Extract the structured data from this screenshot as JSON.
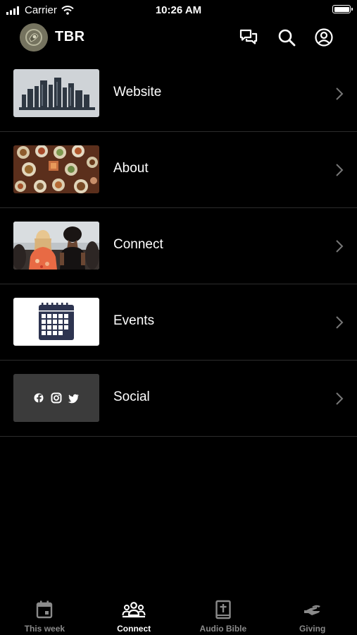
{
  "status": {
    "carrier": "Carrier",
    "time": "10:26 AM"
  },
  "header": {
    "title": "TBR",
    "icons": [
      "chat-icon",
      "search-icon",
      "account-icon"
    ]
  },
  "menu": {
    "items": [
      {
        "label": "Website",
        "thumbnail": "city-skyline"
      },
      {
        "label": "About",
        "thumbnail": "food-table"
      },
      {
        "label": "Connect",
        "thumbnail": "people"
      },
      {
        "label": "Events",
        "thumbnail": "calendar"
      },
      {
        "label": "Social",
        "thumbnail": "social-icons"
      }
    ]
  },
  "tabs": [
    {
      "label": "This week",
      "icon": "calendar-icon",
      "active": false
    },
    {
      "label": "Connect",
      "icon": "group-icon",
      "active": true
    },
    {
      "label": "Audio Bible",
      "icon": "bible-icon",
      "active": false
    },
    {
      "label": "Giving",
      "icon": "giving-icon",
      "active": false
    }
  ]
}
